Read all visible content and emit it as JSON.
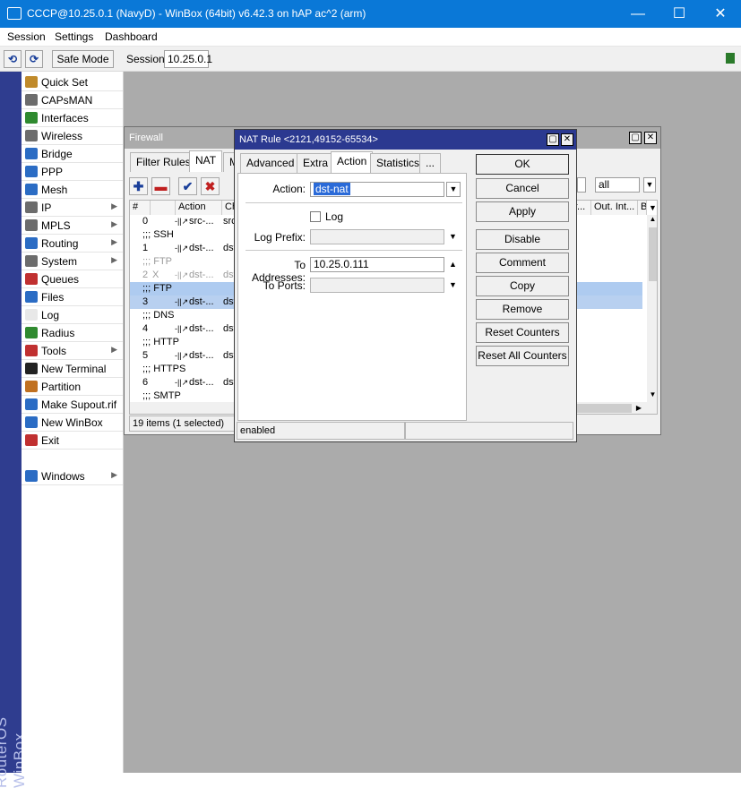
{
  "window": {
    "title": "CCCP@10.25.0.1 (NavyD) - WinBox (64bit) v6.42.3 on hAP ac^2 (arm)",
    "minimize": "—",
    "maximize": "☐",
    "close": "✕"
  },
  "menu": [
    "Session",
    "Settings",
    "Dashboard"
  ],
  "toolbar": {
    "undo": "⟲",
    "redo": "⟳",
    "safe_mode": "Safe Mode",
    "session_label": "Session:",
    "session_value": "10.25.0.1"
  },
  "brand_vertical": "RouterOS WinBox",
  "sidebar": [
    {
      "label": "Quick Set",
      "icon": "quick-set-icon",
      "color": "#c08a2a",
      "submenu": false
    },
    {
      "label": "CAPsMAN",
      "icon": "capsman-icon",
      "color": "#6c6c6c",
      "submenu": false
    },
    {
      "label": "Interfaces",
      "icon": "interfaces-icon",
      "color": "#2f8a2f",
      "submenu": false
    },
    {
      "label": "Wireless",
      "icon": "wireless-icon",
      "color": "#6c6c6c",
      "submenu": false
    },
    {
      "label": "Bridge",
      "icon": "bridge-icon",
      "color": "#2b6cc4",
      "submenu": false
    },
    {
      "label": "PPP",
      "icon": "ppp-icon",
      "color": "#2b6cc4",
      "submenu": false
    },
    {
      "label": "Mesh",
      "icon": "mesh-icon",
      "color": "#2b6cc4",
      "submenu": false
    },
    {
      "label": "IP",
      "icon": "ip-icon",
      "color": "#6c6c6c",
      "submenu": true
    },
    {
      "label": "MPLS",
      "icon": "mpls-icon",
      "color": "#6c6c6c",
      "submenu": true
    },
    {
      "label": "Routing",
      "icon": "routing-icon",
      "color": "#2b6cc4",
      "submenu": true
    },
    {
      "label": "System",
      "icon": "system-icon",
      "color": "#6c6c6c",
      "submenu": true
    },
    {
      "label": "Queues",
      "icon": "queues-icon",
      "color": "#c03030",
      "submenu": false
    },
    {
      "label": "Files",
      "icon": "files-icon",
      "color": "#2b6cc4",
      "submenu": false
    },
    {
      "label": "Log",
      "icon": "log-icon",
      "color": "#e8e8e8",
      "submenu": false
    },
    {
      "label": "Radius",
      "icon": "radius-icon",
      "color": "#2f8a2f",
      "submenu": false
    },
    {
      "label": "Tools",
      "icon": "tools-icon",
      "color": "#c03030",
      "submenu": true
    },
    {
      "label": "New Terminal",
      "icon": "terminal-icon",
      "color": "#222222",
      "submenu": false
    },
    {
      "label": "Partition",
      "icon": "partition-icon",
      "color": "#c07020",
      "submenu": false
    },
    {
      "label": "Make Supout.rif",
      "icon": "supout-icon",
      "color": "#2b6cc4",
      "submenu": false
    },
    {
      "label": "New WinBox",
      "icon": "winbox-icon",
      "color": "#2b6cc4",
      "submenu": false
    },
    {
      "label": "Exit",
      "icon": "exit-icon",
      "color": "#c03030",
      "submenu": false
    },
    {
      "label": "Windows",
      "icon": "windows-icon",
      "color": "#2b6cc4",
      "submenu": true
    }
  ],
  "firewall": {
    "title": "Firewall",
    "tabs": [
      "Filter Rules",
      "NAT",
      "M"
    ],
    "filter_value": "all",
    "columns": [
      "#",
      "Action",
      "Cha"
    ],
    "right_columns": [
      "r...",
      "Out. Int...",
      "B"
    ],
    "rows": [
      {
        "num": "0",
        "flag": "",
        "action": "src-...",
        "chain": "src",
        "type": "rule",
        "state": "normal"
      },
      {
        "num": "",
        "flag": ";;; SSH",
        "action": "",
        "chain": "",
        "type": "comment",
        "state": "normal"
      },
      {
        "num": "1",
        "flag": "",
        "action": "dst-...",
        "chain": "dst",
        "type": "rule",
        "state": "normal"
      },
      {
        "num": "",
        "flag": ";;; FTP",
        "action": "",
        "chain": "",
        "type": "comment",
        "state": "disabled"
      },
      {
        "num": "2",
        "flag": "X",
        "action": "dst-...",
        "chain": "dst",
        "type": "rule",
        "state": "disabled"
      },
      {
        "num": "",
        "flag": ";;; FTP",
        "action": "",
        "chain": "",
        "type": "comment",
        "state": "selected"
      },
      {
        "num": "3",
        "flag": "",
        "action": "dst-...",
        "chain": "dst",
        "type": "rule",
        "state": "selected"
      },
      {
        "num": "",
        "flag": ";;; DNS",
        "action": "",
        "chain": "",
        "type": "comment",
        "state": "normal"
      },
      {
        "num": "4",
        "flag": "",
        "action": "dst-...",
        "chain": "dst",
        "type": "rule",
        "state": "normal"
      },
      {
        "num": "",
        "flag": ";;; HTTP",
        "action": "",
        "chain": "",
        "type": "comment",
        "state": "normal"
      },
      {
        "num": "5",
        "flag": "",
        "action": "dst-...",
        "chain": "dst",
        "type": "rule",
        "state": "normal"
      },
      {
        "num": "",
        "flag": ";;; HTTPS",
        "action": "",
        "chain": "",
        "type": "comment",
        "state": "normal"
      },
      {
        "num": "6",
        "flag": "",
        "action": "dst-...",
        "chain": "dst",
        "type": "rule",
        "state": "normal"
      },
      {
        "num": "",
        "flag": ";;; SMTP",
        "action": "",
        "chain": "",
        "type": "comment",
        "state": "normal"
      }
    ],
    "status": "19 items (1 selected)"
  },
  "nat_rule": {
    "title": "NAT Rule <2121,49152-65534>",
    "tabs": [
      "Advanced",
      "Extra",
      "Action",
      "Statistics",
      "..."
    ],
    "active_tab": "Action",
    "action_label": "Action:",
    "action_value": "dst-nat",
    "log_label": "Log",
    "log_checked": false,
    "log_prefix_label": "Log Prefix:",
    "log_prefix_value": "",
    "to_addresses_label": "To Addresses:",
    "to_addresses_value": "10.25.0.111",
    "to_ports_label": "To Ports:",
    "to_ports_value": "",
    "buttons": [
      "OK",
      "Cancel",
      "Apply",
      "Disable",
      "Comment",
      "Copy",
      "Remove",
      "Reset Counters",
      "Reset All Counters"
    ],
    "status": "enabled"
  }
}
